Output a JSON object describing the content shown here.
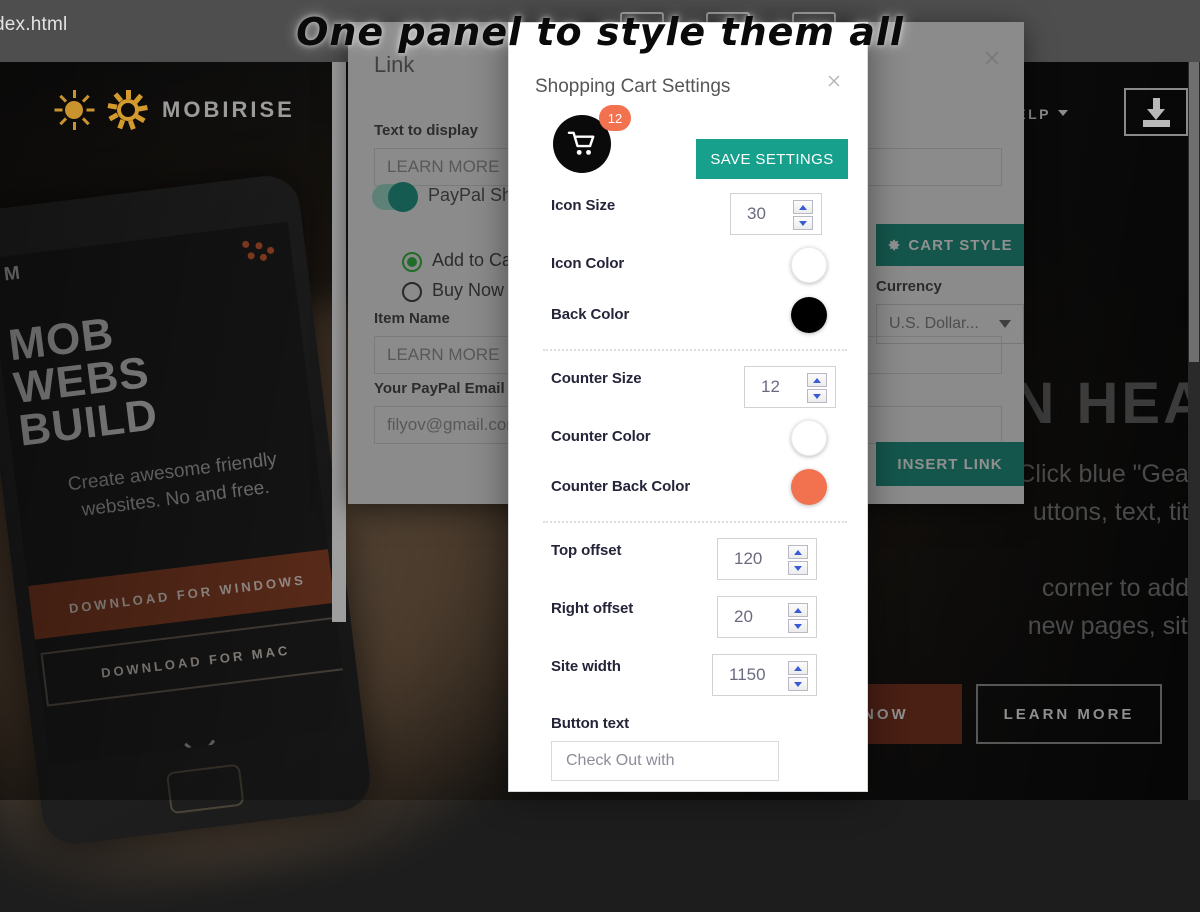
{
  "caption": "One panel to style them all",
  "browser": {
    "tab_title": "dex.html",
    "tabs": [
      "",
      "",
      ""
    ]
  },
  "site": {
    "brand": "MOBIRISE",
    "nav_help": "HELP",
    "download_icon": "download-icon",
    "hero_heading": "N HEA",
    "hero_line1": "Click blue \"Gear\"",
    "hero_line2": "uttons, text, title",
    "hero_line3": "corner to add a",
    "hero_line4": "new pages, sites",
    "btn_now": "D NOW",
    "btn_learn": "LEARN MORE",
    "phone": {
      "logo": "M",
      "title_line1": "MOB",
      "title_line2": "WEBS",
      "title_line3": "BUILD",
      "subtitle": "Create awesome  friendly websites. No  and free.",
      "btn_windows": "DOWNLOAD FOR WINDOWS",
      "btn_mac": "DOWNLOAD FOR MAC"
    }
  },
  "link_dialog": {
    "title": "Link",
    "close_icon": "close-icon",
    "text_to_display_label": "Text to display",
    "text_to_display_value": "LEARN MORE",
    "paypal_toggle_label": "PayPal Shop",
    "paypal_toggle_on": true,
    "radio_add_to_cart": "Add to Car",
    "radio_buy_now": "Buy Now",
    "item_name_label": "Item Name",
    "item_name_value": "LEARN MORE",
    "paypal_email_label": "Your PayPal Email",
    "paypal_email_value": "filyov@gmail.com",
    "cart_style_button": "CART STYLE",
    "cart_style_icon": "gear-icon",
    "currency_label": "Currency",
    "currency_value": "U.S. Dollar...",
    "insert_link_button": "INSERT LINK"
  },
  "cart_modal": {
    "title": "Shopping Cart Settings",
    "close_icon": "close-icon",
    "preview": {
      "icon": "shopping-cart-icon",
      "badge_count": "12",
      "circle_color": "#0a0a0a",
      "badge_color": "#f2714f"
    },
    "save_button": "SAVE SETTINGS",
    "save_button_color": "#17a08c",
    "rows": [
      {
        "label": "Icon Size",
        "type": "spinner",
        "value": "30"
      },
      {
        "label": "Icon Color",
        "type": "color",
        "value": "#ffffff"
      },
      {
        "label": "Back Color",
        "type": "color",
        "value": "#000000"
      },
      {
        "label": "Counter Size",
        "type": "spinner",
        "value": "12"
      },
      {
        "label": "Counter Color",
        "type": "color",
        "value": "#ffffff"
      },
      {
        "label": "Counter Back Color",
        "type": "color",
        "value": "#f2714f"
      },
      {
        "label": "Top offset",
        "type": "spinner",
        "value": "120"
      },
      {
        "label": "Right offset",
        "type": "spinner",
        "value": "20"
      },
      {
        "label": "Site width",
        "type": "spinner",
        "value": "1150"
      }
    ],
    "button_text_label": "Button text",
    "button_text_value": "Check Out with"
  }
}
